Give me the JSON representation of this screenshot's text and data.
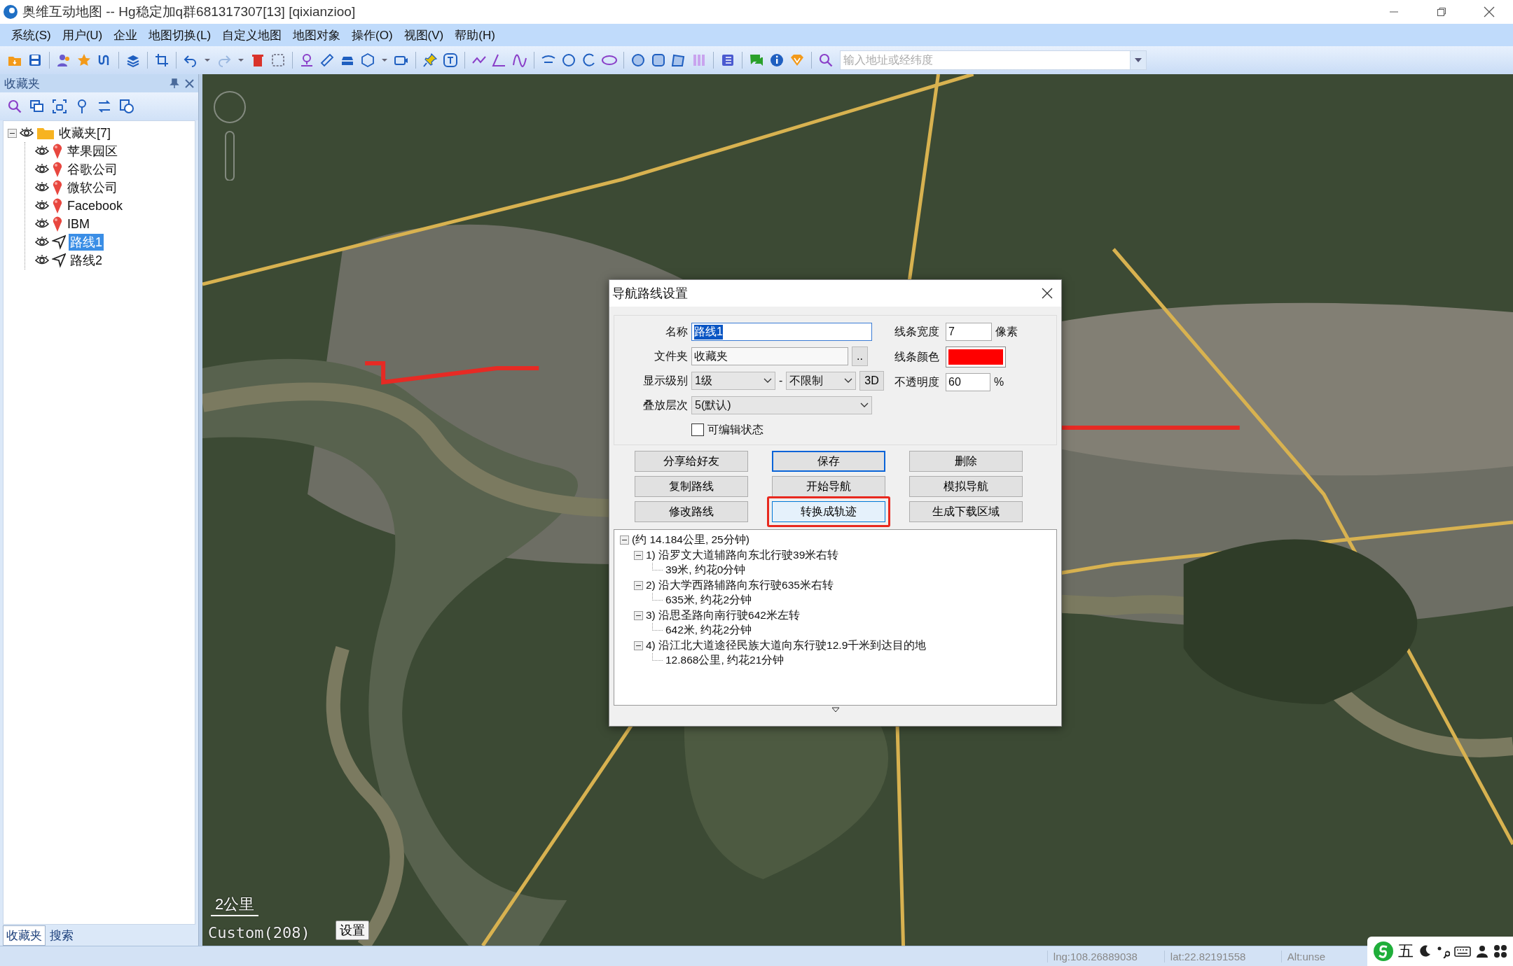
{
  "window": {
    "title": "奥维互动地图 -- Hg稳定加q群681317307[13] [qixianzioo]"
  },
  "menu": [
    {
      "label": "系统(S)"
    },
    {
      "label": "用户(U)"
    },
    {
      "label": "企业"
    },
    {
      "label": "地图切换(L)"
    },
    {
      "label": "自定义地图"
    },
    {
      "label": "地图对象"
    },
    {
      "label": "操作(O)"
    },
    {
      "label": "视图(V)"
    },
    {
      "label": "帮助(H)"
    }
  ],
  "toolbar": {
    "search": {
      "placeholder": "输入地址或经纬度"
    }
  },
  "favorites_panel": {
    "title": "收藏夹",
    "tree": {
      "label": "收藏夹[7]",
      "expanded": true,
      "children": [
        {
          "label": "苹果园区",
          "kind": "place",
          "selected": false
        },
        {
          "label": "谷歌公司",
          "kind": "place",
          "selected": false
        },
        {
          "label": "微软公司",
          "kind": "place",
          "selected": false
        },
        {
          "label": "Facebook",
          "kind": "place",
          "selected": false
        },
        {
          "label": "IBM",
          "kind": "place",
          "selected": false
        },
        {
          "label": "路线1",
          "kind": "route",
          "selected": true
        },
        {
          "label": "路线2",
          "kind": "route",
          "selected": false
        }
      ]
    },
    "tabs": [
      {
        "label": "收藏夹",
        "selected": true
      },
      {
        "label": "搜索",
        "selected": false
      }
    ]
  },
  "map": {
    "kind": "picture",
    "scale": "2公里",
    "layer": "Custom(208)",
    "settings_button": "设置"
  },
  "dialog": {
    "title": "导航路线设置",
    "name": {
      "label": "名称",
      "value": "路线1"
    },
    "folder": {
      "label": "文件夹",
      "value": "收藏夹",
      "browse": ".."
    },
    "display_level": {
      "label": "显示级别",
      "from": "1级",
      "separator": "-",
      "to": "不限制",
      "mode_button": "3D"
    },
    "layer": {
      "label": "叠放层次",
      "value": "5(默认)"
    },
    "editable": {
      "label": "可编辑状态",
      "checked": false
    },
    "line_width": {
      "label": "线条宽度",
      "value": "7",
      "unit": "像素"
    },
    "line_color": {
      "label": "线条颜色",
      "color": "#ff0000"
    },
    "opacity": {
      "label": "不透明度",
      "value": "60",
      "unit": "%"
    },
    "buttons": [
      {
        "label": "分享给好友",
        "focused": false,
        "highlighted": false
      },
      {
        "label": "保存",
        "focused": true,
        "highlighted": false
      },
      {
        "label": "删除",
        "focused": false,
        "highlighted": false
      },
      {
        "label": "复制路线",
        "focused": false,
        "highlighted": false
      },
      {
        "label": "开始导航",
        "focused": false,
        "highlighted": false
      },
      {
        "label": "模拟导航",
        "focused": false,
        "highlighted": false
      },
      {
        "label": "修改路线",
        "focused": false,
        "highlighted": false
      },
      {
        "label": "转换成轨迹",
        "focused": false,
        "highlighted": true
      },
      {
        "label": "生成下载区域",
        "focused": false,
        "highlighted": false
      }
    ],
    "route_steps": [
      {
        "label": "(约 14.184公里, 25分钟)",
        "expanded": true,
        "children": [
          {
            "label": "1) 沿罗文大道辅路向东北行驶39米右转",
            "expanded": true,
            "children": [
              {
                "label": "39米, 约花0分钟"
              }
            ]
          },
          {
            "label": "2) 沿大学西路辅路向东行驶635米右转",
            "expanded": true,
            "children": [
              {
                "label": "635米, 约花2分钟"
              }
            ]
          },
          {
            "label": "3) 沿思圣路向南行驶642米左转",
            "expanded": true,
            "children": [
              {
                "label": "642米, 约花2分钟"
              }
            ]
          },
          {
            "label": "4) 沿江北大道途径民族大道向东行驶12.9千米到达目的地",
            "expanded": true,
            "children": [
              {
                "label": "12.868公里, 约花21分钟"
              }
            ]
          }
        ]
      }
    ]
  },
  "status_bar": {
    "lng": "lng:108.26889038",
    "lat": "lat:22.82191558",
    "alt": "Alt:unse"
  },
  "ime": {
    "mode": "五"
  }
}
